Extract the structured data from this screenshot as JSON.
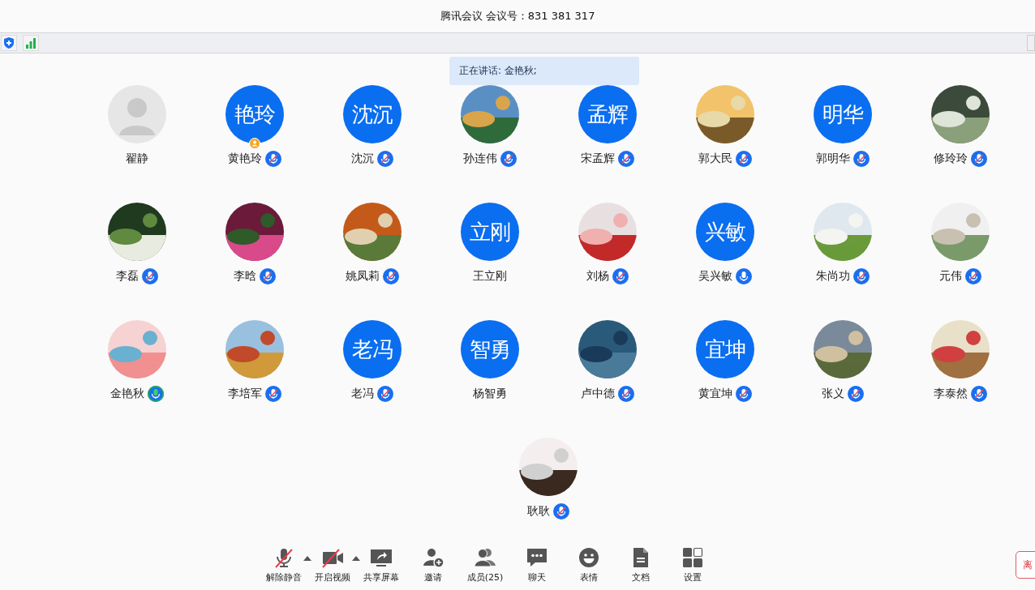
{
  "window": {
    "title": "腾讯会议 会议号：831 381 317"
  },
  "speaking_tip": "正在讲话: 金艳秋;",
  "participants": [
    {
      "name": "翟静",
      "avatar": {
        "kind": "placeholder"
      },
      "host": false
    },
    {
      "name": "黄艳玲",
      "avatar": {
        "kind": "initials",
        "text": "艳玲"
      },
      "host": true,
      "mic": {
        "muted": true,
        "speaking": false
      }
    },
    {
      "name": "沈沉",
      "avatar": {
        "kind": "initials",
        "text": "沈沉"
      },
      "host": false,
      "mic": {
        "muted": true,
        "speaking": false
      }
    },
    {
      "name": "孙连伟",
      "host": false,
      "mic": {
        "muted": true,
        "speaking": false
      }
    },
    {
      "name": "宋孟辉",
      "avatar": {
        "kind": "initials",
        "text": "孟辉"
      },
      "host": false,
      "mic": {
        "muted": true,
        "speaking": false
      }
    },
    {
      "name": "郭大民",
      "host": false,
      "mic": {
        "muted": true,
        "speaking": false
      }
    },
    {
      "name": "郭明华",
      "avatar": {
        "kind": "initials",
        "text": "明华"
      },
      "host": false,
      "mic": {
        "muted": true,
        "speaking": false
      }
    },
    {
      "name": "修玲玲",
      "host": false,
      "mic": {
        "muted": true,
        "speaking": false
      }
    },
    {
      "name": "李磊",
      "host": false,
      "mic": {
        "muted": true,
        "speaking": false
      }
    },
    {
      "name": "李晗",
      "host": false,
      "mic": {
        "muted": true,
        "speaking": false
      }
    },
    {
      "name": "姚凤莉",
      "host": false,
      "mic": {
        "muted": true,
        "speaking": false
      }
    },
    {
      "name": "王立刚",
      "avatar": {
        "kind": "initials",
        "text": "立刚"
      },
      "host": false
    },
    {
      "name": "刘杨",
      "host": false,
      "mic": {
        "muted": true,
        "speaking": false
      }
    },
    {
      "name": "吴兴敏",
      "avatar": {
        "kind": "initials",
        "text": "兴敏"
      },
      "host": false,
      "mic": {
        "muted": false,
        "speaking": false
      }
    },
    {
      "name": "朱尚功",
      "host": false,
      "mic": {
        "muted": true,
        "speaking": false
      }
    },
    {
      "name": "元伟",
      "host": false,
      "mic": {
        "muted": true,
        "speaking": false
      }
    },
    {
      "name": "金艳秋",
      "host": false,
      "mic": {
        "muted": false,
        "speaking": true
      }
    },
    {
      "name": "李培军",
      "host": false,
      "mic": {
        "muted": true,
        "speaking": false
      }
    },
    {
      "name": "老冯",
      "avatar": {
        "kind": "initials",
        "text": "老冯"
      },
      "host": false,
      "mic": {
        "muted": true,
        "speaking": false
      }
    },
    {
      "name": "杨智勇",
      "avatar": {
        "kind": "initials",
        "text": "智勇"
      },
      "host": false
    },
    {
      "name": "卢中德",
      "host": false,
      "mic": {
        "muted": true,
        "speaking": false
      }
    },
    {
      "name": "黄宜坤",
      "avatar": {
        "kind": "initials",
        "text": "宜坤"
      },
      "host": false,
      "mic": {
        "muted": true,
        "speaking": false
      }
    },
    {
      "name": "张义",
      "host": false,
      "mic": {
        "muted": true,
        "speaking": false
      }
    },
    {
      "name": "李泰然",
      "host": false,
      "mic": {
        "muted": true,
        "speaking": false
      }
    },
    {
      "name": "耿耿",
      "host": false,
      "mic": {
        "muted": true,
        "speaking": false
      }
    }
  ],
  "toolbar": [
    {
      "kind": "mic",
      "label": "解除静音",
      "off": true,
      "menu": true
    },
    {
      "kind": "video",
      "label": "开启视频",
      "off": true,
      "menu": true
    },
    {
      "kind": "share",
      "label": "共享屏幕",
      "menu": false
    },
    {
      "kind": "invite",
      "label": "邀请",
      "menu": false
    },
    {
      "kind": "members",
      "label": "成员(25)",
      "menu": false
    },
    {
      "kind": "chat",
      "label": "聊天",
      "menu": false
    },
    {
      "kind": "emoji",
      "label": "表情",
      "menu": false
    },
    {
      "kind": "docs",
      "label": "文档",
      "menu": false
    },
    {
      "kind": "settings",
      "label": "设置",
      "menu": false
    }
  ],
  "leave_button": "离"
}
